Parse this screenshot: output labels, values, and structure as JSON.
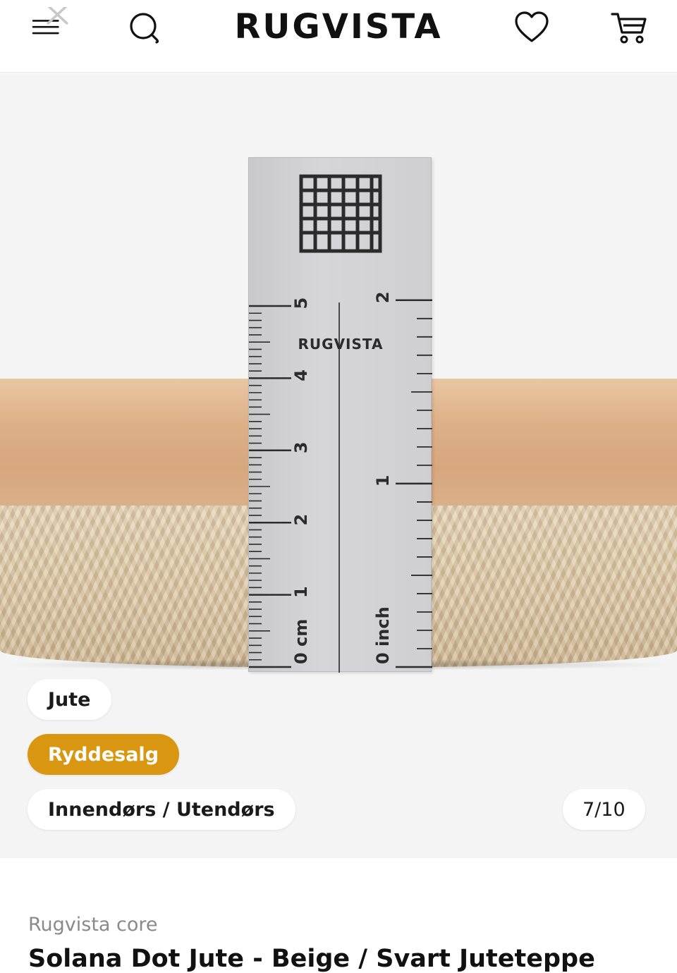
{
  "header": {
    "logo": "RUGVISTA",
    "icons": [
      "menu-icon",
      "close-icon",
      "search-icon",
      "heart-icon",
      "cart-icon"
    ]
  },
  "gallery": {
    "ruler": {
      "brand": "RUGVISTA",
      "cm_labels": [
        "0 cm",
        "1",
        "2",
        "3",
        "4",
        "5"
      ],
      "inch_labels": [
        "0 inch",
        "1",
        "2"
      ]
    },
    "tags": [
      "Jute",
      "Ryddesalg",
      "Innendørs / Utendørs"
    ],
    "counter": "7/10"
  },
  "product": {
    "brand": "Rugvista core",
    "title": "Solana Dot Jute - Beige / Svart Juteteppe"
  },
  "colors": {
    "accent": "#d99610",
    "text": "#111111",
    "muted": "#8a8a8a",
    "gallery_bg": "#f4f4f4"
  }
}
